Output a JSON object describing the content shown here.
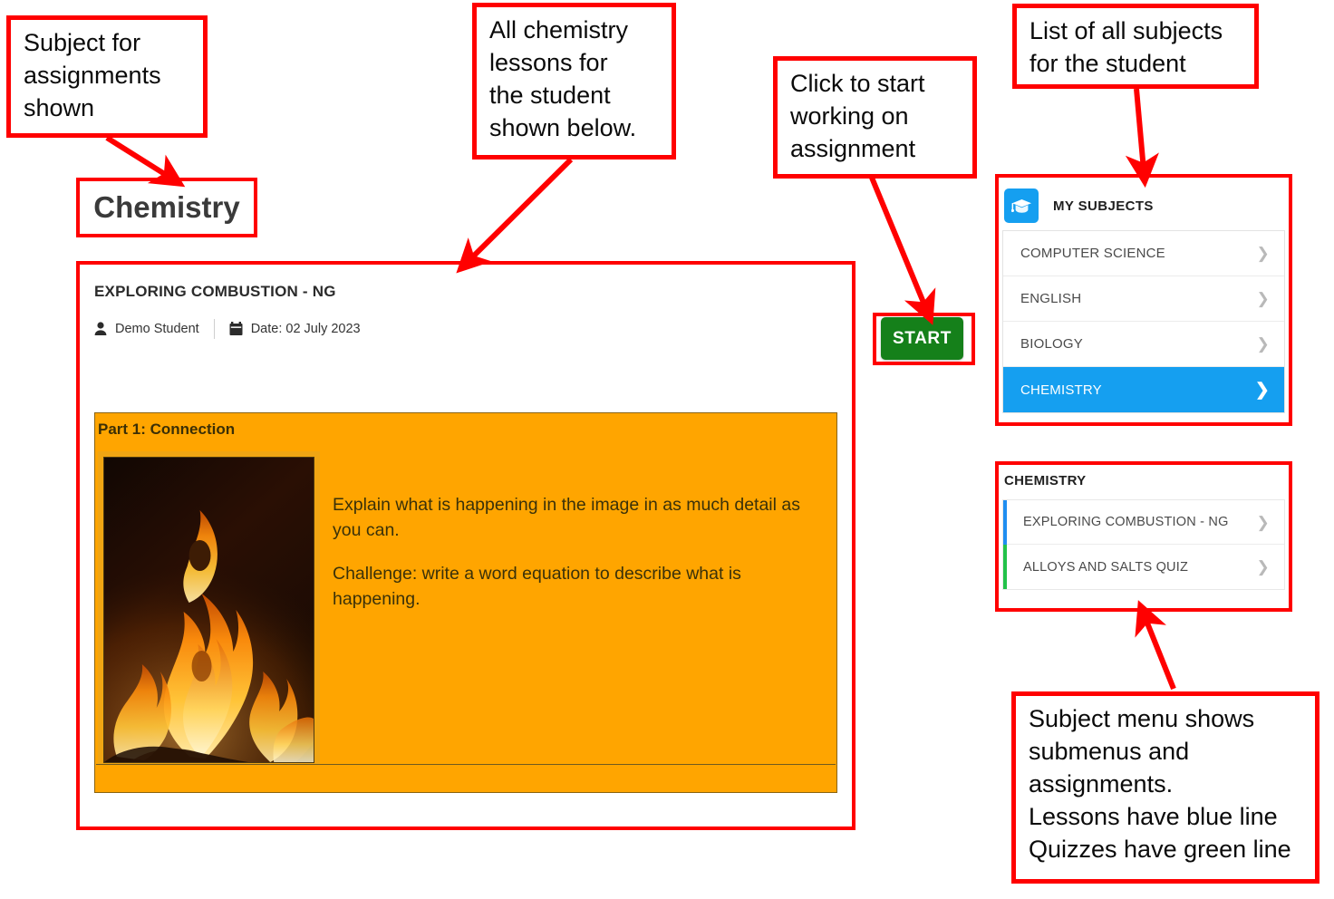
{
  "annotations": {
    "subject_for_assignments": "Subject for\nassignments\nshown",
    "all_chemistry_lessons": "All chemistry\nlessons for\nthe student\nshown below.",
    "click_to_start": "Click to start\nworking on\nassignment",
    "list_of_all_subjects": "List of all subjects\nfor the student",
    "subject_menu_note": "Subject menu shows\nsubmenus and\nassignments.\nLessons have blue line\nQuizzes have green line"
  },
  "subject_heading": "Chemistry",
  "assignment_card": {
    "title": "EXPLORING COMBUSTION - NG",
    "student_icon": "person-icon",
    "student_name": "Demo Student",
    "date_icon": "calendar-icon",
    "date_label": "Date: 02 July 2023",
    "part": {
      "heading": "Part 1: Connection",
      "image_alt": "fire-flames-photo",
      "paragraphs": [
        "Explain what is happening in the image in as much detail as you can.",
        "Challenge: write a word equation to describe what is happening."
      ]
    }
  },
  "start_button": {
    "label": "START",
    "color": "#15801a"
  },
  "my_subjects": {
    "icon": "graduation-cap-icon",
    "title": "MY SUBJECTS",
    "accent_color": "#159ff0",
    "items": [
      {
        "label": "COMPUTER SCIENCE",
        "active": false
      },
      {
        "label": "ENGLISH",
        "active": false
      },
      {
        "label": "BIOLOGY",
        "active": false
      },
      {
        "label": "CHEMISTRY",
        "active": true
      }
    ]
  },
  "subject_submenu": {
    "title": "CHEMISTRY",
    "lesson_color": "#1f8ef1",
    "quiz_color": "#22c24a",
    "items": [
      {
        "label": "EXPLORING COMBUSTION - NG",
        "type": "lesson"
      },
      {
        "label": "ALLOYS AND SALTS QUIZ",
        "type": "quiz"
      }
    ]
  },
  "colors": {
    "annotation": "#ff0000",
    "panel_orange": "#ffa500"
  }
}
